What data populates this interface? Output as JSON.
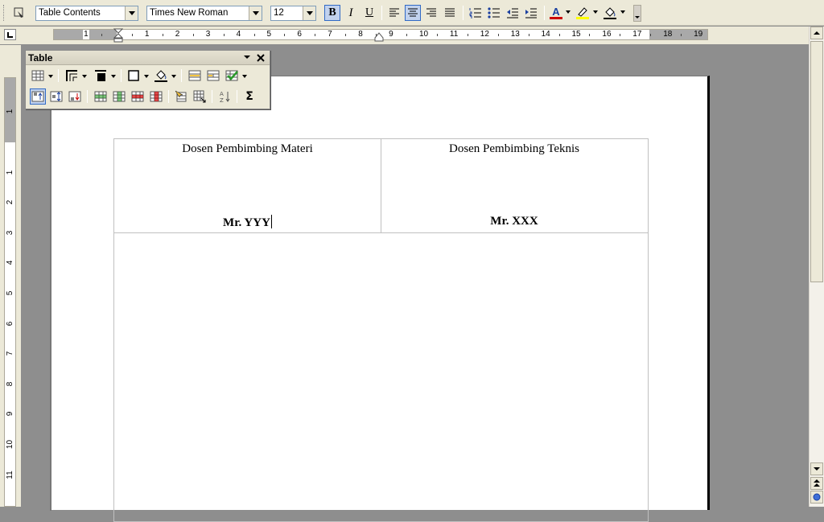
{
  "toolbar": {
    "style_value": "Table Contents",
    "font_value": "Times New Roman",
    "size_value": "12",
    "bold_label": "B",
    "italic_label": "I",
    "underline_label": "U",
    "font_color_label": "A",
    "colors": {
      "font_color": "#cc0000",
      "highlight": "#ffff00",
      "active_border": "#316ac5"
    }
  },
  "ruler": {
    "h_labels": [
      "1",
      "1",
      "2",
      "3",
      "4",
      "5",
      "6",
      "7",
      "8",
      "9",
      "10",
      "11",
      "12",
      "13",
      "14",
      "15",
      "16",
      "17",
      "18",
      "19"
    ],
    "v_labels": [
      "1",
      "1",
      "2",
      "3",
      "4",
      "5",
      "6",
      "7",
      "8",
      "9",
      "10",
      "11"
    ]
  },
  "table_panel": {
    "title": "Table",
    "sum_label": "Σ"
  },
  "document": {
    "cells": [
      {
        "heading": "Dosen Pembimbing  Materi",
        "name": "Mr. YYY"
      },
      {
        "heading": "Dosen Pembimbing  Teknis",
        "name": "Mr. XXX"
      }
    ]
  }
}
